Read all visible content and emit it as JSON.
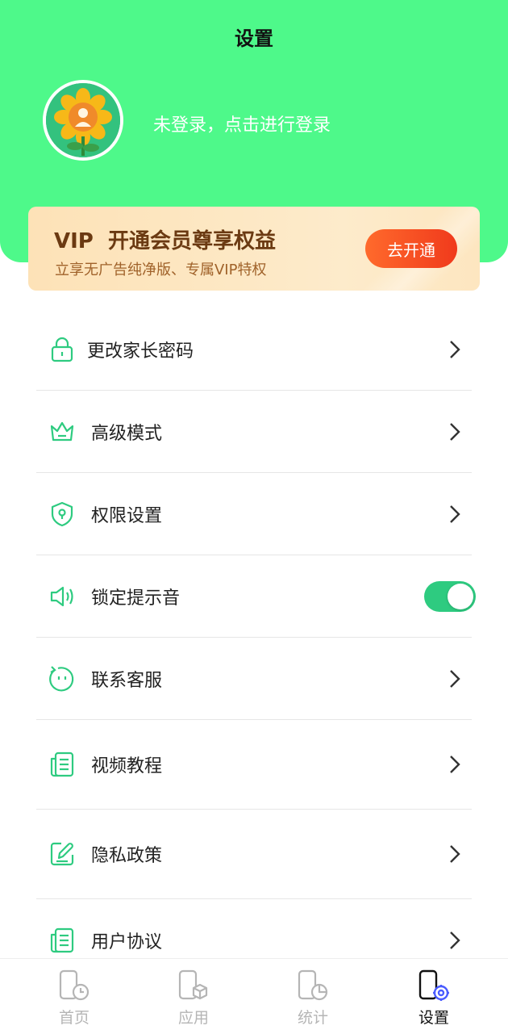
{
  "page": {
    "title": "设置"
  },
  "user": {
    "login_prompt": "未登录，点击进行登录"
  },
  "vip": {
    "title": "VIP  开通会员尊享权益",
    "subtitle": "立享无广告纯净版、专属VIP特权",
    "button_label": "去开通"
  },
  "menu": {
    "items": [
      {
        "label": "更改家长密码",
        "icon": "lock-icon"
      },
      {
        "label": "高级模式",
        "icon": "crown-icon"
      },
      {
        "label": "权限设置",
        "icon": "shield-icon"
      },
      {
        "label": "锁定提示音",
        "icon": "speaker-icon",
        "toggle_on": true
      },
      {
        "label": "联系客服",
        "icon": "smile-chat-icon"
      },
      {
        "label": "视频教程",
        "icon": "document-icon"
      },
      {
        "label": "隐私政策",
        "icon": "edit-icon"
      },
      {
        "label": "用户协议",
        "icon": "document-icon"
      }
    ]
  },
  "tabbar": {
    "tabs": [
      {
        "label": "首页",
        "icon": "phone-clock-icon",
        "active": false
      },
      {
        "label": "应用",
        "icon": "phone-cube-icon",
        "active": false
      },
      {
        "label": "统计",
        "icon": "phone-chart-icon",
        "active": false
      },
      {
        "label": "设置",
        "icon": "phone-gear-icon",
        "active": true
      }
    ]
  },
  "colors": {
    "header": "#4ef98a",
    "accent": "#2ecb80",
    "vip_button": "#f03a1c",
    "vip_text": "#6b3a12"
  }
}
